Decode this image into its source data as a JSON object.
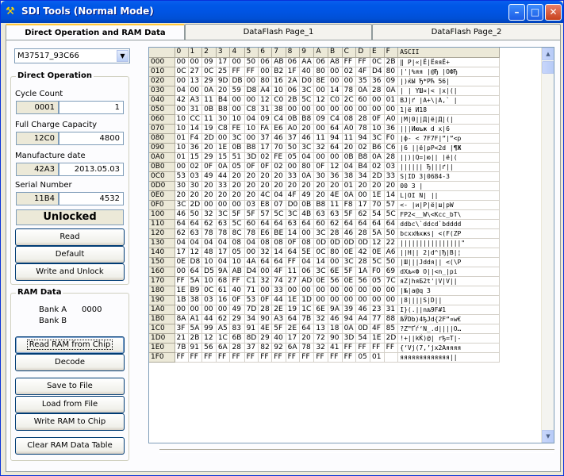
{
  "window": {
    "title": "SDI Tools (Normal Mode)"
  },
  "tabs": [
    "Direct Operation   and   RAM Data",
    "DataFlash Page_1",
    "DataFlash Page_2"
  ],
  "device": {
    "selected": "M37517_93C66"
  },
  "direct_operation": {
    "title": "Direct Operation",
    "cycle_count": {
      "label": "Cycle Count",
      "hex": "0001",
      "value": "1"
    },
    "full_charge": {
      "label": "Full Charge Capacity",
      "hex": "12C0",
      "value": "4800"
    },
    "manufacture": {
      "label": "Manufacture date",
      "hex": "42A3",
      "value": "2013.05.03"
    },
    "serial": {
      "label": "Serial Number",
      "hex": "11B4",
      "value": "4532"
    },
    "status": "Unlocked",
    "read": "Read",
    "default": "Default",
    "write_unlock": "Write and Unlock"
  },
  "ram_data": {
    "title": "RAM Data",
    "bank_a_label": "Bank A",
    "bank_a_value": "0000",
    "bank_b_label": "Bank B",
    "read_ram": "Read RAM from Chip",
    "decode": "Decode",
    "save": "Save to File",
    "load": "Load from File",
    "write_ram": "Write RAM to Chip",
    "clear": "Clear RAM Data Table"
  },
  "hex_table": {
    "columns": [
      "0",
      "1",
      "2",
      "3",
      "4",
      "5",
      "6",
      "7",
      "8",
      "9",
      "A",
      "B",
      "C",
      "D",
      "E",
      "F"
    ],
    "ascii_header": "ASCII",
    "rows": [
      [
        "000",
        "00 00 09 17 00 50 06 AB 06 AA 06 A8 FF FF 0C 2B",
        "   ‖  P|«|Ё|ЁяяЁ+"
      ],
      [
        "010",
        "0C 27 0C 25 FF FF 00 B2 1F 40 80 00 02 4F D4 80",
        "|'|%яя |@Ђ |ОФЂ"
      ],
      [
        "020",
        "00 13 29 9D DB 00 80 16 2A D0 8E 00 00 35 36 09",
        "|)ќЫ Ђ*РЋ  56|"
      ],
      [
        "030",
        "04 00 0A 20 59 D8 A4 10 06 3C 00 14 78 0A 28 0A",
        "| |  YШ¤|< |x|(|"
      ],
      [
        "040",
        "42 A3 11 B4 00 00 12 C0 2B 5C 12 C0 2C 60 00 01",
        "BЈ|ґ  |А+\\|А,` |"
      ],
      [
        "050",
        "00 31 0B B8 00 C8 31 38 00 00 00 00 00 00 00 00",
        " 1|ё И18        "
      ],
      [
        "060",
        "10 CC 11 30 10 04 09 C4 0B B8 09 C4 08 28 0F A0",
        "|М|0||Д|ё|Д|(| "
      ],
      [
        "070",
        "10 14 19 C8 FE 10 FA E6 A0 20 00 64 A0 78 10 36",
        "|||Июъж  d x|6"
      ],
      [
        "080",
        "01 F4 2D 00 3C 00 37 46 37 46 11 94 11 94 3C F0",
        "|ф- < 7F7F|”|”<р"
      ],
      [
        "090",
        "10 36 20 1E 0B B8 17 70 50 3C 32 64 20 02 B6 C6",
        "|6 ||ё|pP<2d |¶Ж"
      ],
      [
        "0A0",
        "01 15 29 15 51 3D 02 FE 05 04 00 00 0B B8 0A 28",
        "||)|Q=|ю||  |ё|("
      ],
      [
        "0B0",
        "00 02 0F 0A 05 0F 0F 02 00 80 0F 12 04 B4 02 03",
        " |||||| Ђ|||ґ||"
      ],
      [
        "0C0",
        "53 03 49 44 20 20 20 20 33 0A 30 36 38 34 2D 33",
        "S|ID    3|0684-3"
      ],
      [
        "0D0",
        "30 30 20 33 20 20 20 20 20 20 20 20 01 20 20 20",
        "00 3        |   "
      ],
      [
        "0E0",
        "20 20 20 20 20 20 4C 04 4F 49 20 4E 0A 00 1E 14",
        "      L|OI N|  ||"
      ],
      [
        "0F0",
        "3C 2D 00 00 00 03 E8 07 D0 0B B8 11 F8 17 70 57",
        "<-   |и|Р|ё|ш|pW"
      ],
      [
        "100",
        "46 50 32 3C 5F 5F 57 5C 3C 4B 63 63 5F 62 54 5C",
        "FP2<__W\\<Kcc_bT\\"
      ],
      [
        "110",
        "64 64 62 63 5C 60 64 64 63 64 60 62 64 64 64 64",
        "ddbc\\`ddcd`bdddd"
      ],
      [
        "120",
        "62 63 78 78 8C 78 E6 BE 14 00 3C 28 46 28 5A 50",
        "bcxxЊxжѕ| <(F(ZP"
      ],
      [
        "130",
        "04 04 04 04 08 04 08 08 0F 08 0D 0D 0D 0D 12 22",
        "||||||||||||||||\""
      ],
      [
        "140",
        "17 12 48 17 05 00 32 14 64 5E 0C 80 0E 42 0E A6",
        "||H|| 2|d^|Ђ|B|¦"
      ],
      [
        "150",
        "0E D8 10 04 10 4A 64 64 FF 04 14 00 3C 28 5C 50",
        "|Ш|||Jddя|| <(\\P"
      ],
      [
        "160",
        "00 64 D5 9A AB D4 00 4F 11 06 3C 6E 5F 1A F0 69",
        " dХљ«Ф O||<n_|рi"
      ],
      [
        "170",
        "FF 5A 10 68 FF C1 32 74 27 AD 0E 56 0E 56 05 7C",
        "яZ|hяБ2t'­|V|V||"
      ],
      [
        "180",
        "1E B9 0C 61 40 71 00 33 00 00 00 00 00 00 00 00",
        "|№|a@q 3        "
      ],
      [
        "190",
        "1B 38 03 16 0F 53 0F 44 1E 1D 00 00 00 00 00 00",
        "|8||||S|D||      "
      ],
      [
        "1A0",
        "00 00 00 00 49 7D 28 2E 19 1C 6E 9A 39 46 23 31",
        "    I}(.||nљ9F#1"
      ],
      [
        "1B0",
        "8A A1 44 62 29 34 90 A3 64 7B 32 46 94 A4 77 88",
        "ЉЎDb)4ђЈd{2F”¤w€"
      ],
      [
        "1C0",
        "3F 5A 99 A5 83 91 4E 5F 2E 64 13 18 0A 0D 4F 85",
        "?Z™Ґѓ‘N_.d||||O…"
      ],
      [
        "1D0",
        "21 2B 12 1C 6B 8D 29 40 17 20 72 90 3D 54 1E 2D",
        "!+||kЌ)@| rђ=T|-"
      ],
      [
        "1E0",
        "7B 91 56 6A 28 37 82 92 6A 78 32 41 FF FF FF FF",
        "{‘Vj(7‚’jx2Aяяяя"
      ],
      [
        "1F0",
        "FF FF FF FF FF FF FF FF FF FF FF FF FF 05 01",
        "яяяяяяяяяяяяя||"
      ]
    ]
  }
}
